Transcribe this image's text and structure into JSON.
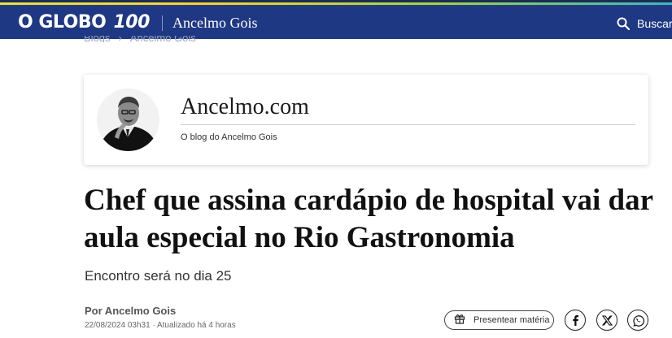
{
  "header": {
    "logo_text": "O GLOBO",
    "logo_number": "100",
    "section": "Ancelmo Gois",
    "search_label": "Buscar",
    "search_icon": "search-icon"
  },
  "breadcrumb": [
    "Blogs",
    "Ancelmo Gois"
  ],
  "blog": {
    "name": "Ancelmo.com",
    "description": "O blog do Ancelmo Gois"
  },
  "article": {
    "headline": "Chef que assina cardápio de hospital vai dar aula especial no Rio Gastronomia",
    "subtitle": "Encontro será no dia 25",
    "author": "Por Ancelmo Gois",
    "dateline": "22/08/2024 03h31 · Atualizado há 4 horas"
  },
  "actions": {
    "gift_label": "Presentear matéria",
    "share_icons": [
      "facebook-icon",
      "x-icon",
      "whatsapp-icon"
    ]
  },
  "colors": {
    "header_bg": "#1f3884",
    "text_dark": "#111111"
  }
}
